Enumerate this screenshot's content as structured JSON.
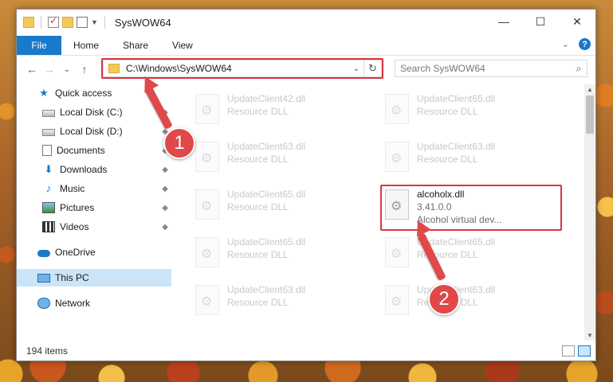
{
  "window": {
    "title": "SysWOW64",
    "controls": {
      "minimize": "—",
      "maximize": "☐",
      "close": "✕"
    }
  },
  "ribbon": {
    "tabs": [
      "File",
      "Home",
      "Share",
      "View"
    ],
    "help": "?",
    "collapse": "⌄"
  },
  "nav": {
    "back": "←",
    "forward": "→",
    "recent": "⌄",
    "up": "↑",
    "address": "C:\\Windows\\SysWOW64",
    "address_dropdown": "⌄",
    "refresh": "↻",
    "search_placeholder": "Search SysWOW64",
    "search_icon": "⌕"
  },
  "sidebar": {
    "items": [
      {
        "label": "Quick access",
        "icon": "star-icon",
        "pinned": false
      },
      {
        "label": "Local Disk (C:)",
        "icon": "drive-icon",
        "pinned": true
      },
      {
        "label": "Local Disk (D:)",
        "icon": "drive-icon",
        "pinned": true
      },
      {
        "label": "Documents",
        "icon": "documents-icon",
        "pinned": true
      },
      {
        "label": "Downloads",
        "icon": "download-icon",
        "pinned": true
      },
      {
        "label": "Music",
        "icon": "music-icon",
        "pinned": true
      },
      {
        "label": "Pictures",
        "icon": "pictures-icon",
        "pinned": true
      },
      {
        "label": "Videos",
        "icon": "videos-icon",
        "pinned": true
      },
      {
        "label": "OneDrive",
        "icon": "cloud-icon",
        "pinned": false
      },
      {
        "label": "This PC",
        "icon": "pc-icon",
        "pinned": false,
        "selected": true
      },
      {
        "label": "Network",
        "icon": "network-icon",
        "pinned": false
      }
    ],
    "pin_glyph": "📌"
  },
  "files": [
    {
      "name": "UpdateClient42.dll",
      "meta": "Resource DLL",
      "faded": true
    },
    {
      "name": "UpdateClient65.dll",
      "meta": "Resource DLL",
      "faded": true
    },
    {
      "name": "UpdateClient63.dll",
      "meta": "Resource DLL",
      "faded": true
    },
    {
      "name": "UpdateClient63.dll",
      "meta": "Resource DLL",
      "faded": true
    },
    {
      "name": "UpdateClient65.dll",
      "meta": "Resource DLL",
      "faded": true
    },
    {
      "name": "alcoholx.dll",
      "meta": "3.41.0.0",
      "meta2": "Alcohol virtual dev...",
      "faded": false
    },
    {
      "name": "UpdateClient65.dll",
      "meta": "Resource DLL",
      "faded": true
    },
    {
      "name": "UpdateClient65.dll",
      "meta": "Resource DLL",
      "faded": true
    },
    {
      "name": "UpdateClient63.dll",
      "meta": "Resource DLL",
      "faded": true
    },
    {
      "name": "UpdateClient63.dll",
      "meta": "Resource DLL",
      "faded": true
    }
  ],
  "status": {
    "item_count": "194 items"
  },
  "callouts": {
    "step1": "1",
    "step2": "2"
  },
  "colors": {
    "accent": "#1979ca",
    "highlight": "#d9363e",
    "callout": "#e0484a",
    "selected": "#cce4f7"
  }
}
